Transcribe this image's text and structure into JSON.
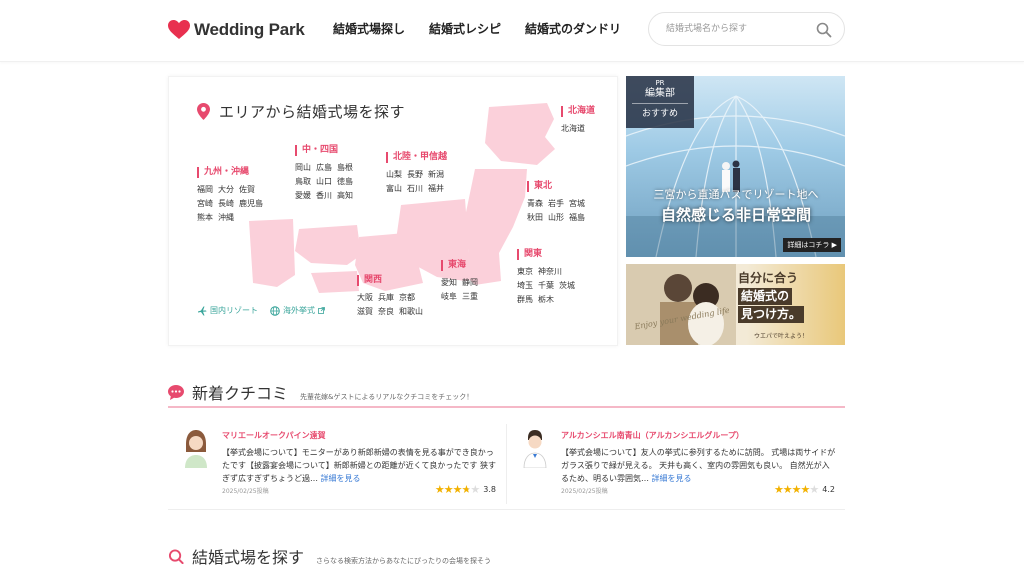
{
  "header": {
    "logo_text": "Wedding Park",
    "nav": [
      "結婚式場探し",
      "結婚式レシピ",
      "結婚式のダンドリ"
    ],
    "search_placeholder": "結婚式場名から探す"
  },
  "area": {
    "title": "エリアから結婚式場を探す",
    "regions": [
      {
        "name": "北海道",
        "rows": [
          [
            "北海道"
          ]
        ]
      },
      {
        "name": "中・四国",
        "rows": [
          [
            "岡山",
            "広島",
            "島根"
          ],
          [
            "鳥取",
            "山口",
            "徳島"
          ],
          [
            "愛媛",
            "香川",
            "高知"
          ]
        ]
      },
      {
        "name": "北陸・甲信越",
        "rows": [
          [
            "山梨",
            "長野",
            "新潟"
          ],
          [
            "富山",
            "石川",
            "福井"
          ]
        ]
      },
      {
        "name": "九州・沖縄",
        "rows": [
          [
            "福岡",
            "大分",
            "佐賀"
          ],
          [
            "宮崎",
            "長崎",
            "鹿児島"
          ],
          [
            "熊本",
            "沖縄"
          ]
        ]
      },
      {
        "name": "東北",
        "rows": [
          [
            "青森",
            "岩手",
            "宮城"
          ],
          [
            "秋田",
            "山形",
            "福島"
          ]
        ]
      },
      {
        "name": "関東",
        "rows": [
          [
            "東京",
            "神奈川"
          ],
          [
            "埼玉",
            "千葉",
            "茨城"
          ],
          [
            "群馬",
            "栃木"
          ]
        ]
      },
      {
        "name": "東海",
        "rows": [
          [
            "愛知",
            "静岡"
          ],
          [
            "岐阜",
            "三重"
          ]
        ]
      },
      {
        "name": "関西",
        "rows": [
          [
            "大阪",
            "兵庫",
            "京都"
          ],
          [
            "滋賀",
            "奈良",
            "和歌山"
          ]
        ]
      }
    ],
    "links": [
      "国内リゾート",
      "海外挙式"
    ]
  },
  "banner1": {
    "badge_pr": "PR",
    "badge_line1": "編集部",
    "badge_line2": "おすすめ",
    "caption1": "三宮から直通バスでリゾート地へ",
    "caption2": "自然感じる非日常空間",
    "more": "詳細はコチラ"
  },
  "banner2": {
    "lines": [
      "自分に合う",
      "結婚式の",
      "見つけ方。"
    ],
    "sub": "ウエパで叶えよう！",
    "cursive": "Enjoy your wedding life"
  },
  "reviews_section": {
    "heading": "新着クチコミ",
    "desc": "先輩花嫁&ゲストによるリアルなクチコミをチェック！"
  },
  "reviews": [
    {
      "venue": "マリエールオークパイン遠賀",
      "text": "【挙式会場について】モニターがあり新郎新婦の表情を見る事ができ良かったです【披露宴会場について】新郎新婦との距離が近くて良かったです 狭すぎず広すぎずちょうど過…",
      "more": "詳細を見る",
      "date": "2025/02/25投稿",
      "score": "3.8",
      "rating": 3.8
    },
    {
      "venue": "アルカンシエル南青山（アルカンシエルグループ）",
      "text": "【挙式会場について】友人の挙式に参列するために訪問。 式場は両サイドがガラス張りで緑が見える。 天井も高く、室内の雰囲気も良い。 自然光が入るため、明るい雰囲気…",
      "more": "詳細を見る",
      "date": "2025/02/25投稿",
      "score": "4.2",
      "rating": 4.2
    }
  ],
  "search_section": {
    "heading": "結婚式場を探す",
    "desc": "さらなる検索方法からあなたにぴったりの会場を探そう"
  },
  "colors": {
    "brand": "#e74a6e",
    "map": "#fbd0da",
    "teal": "#3aa59b",
    "star": "#f2b100"
  }
}
